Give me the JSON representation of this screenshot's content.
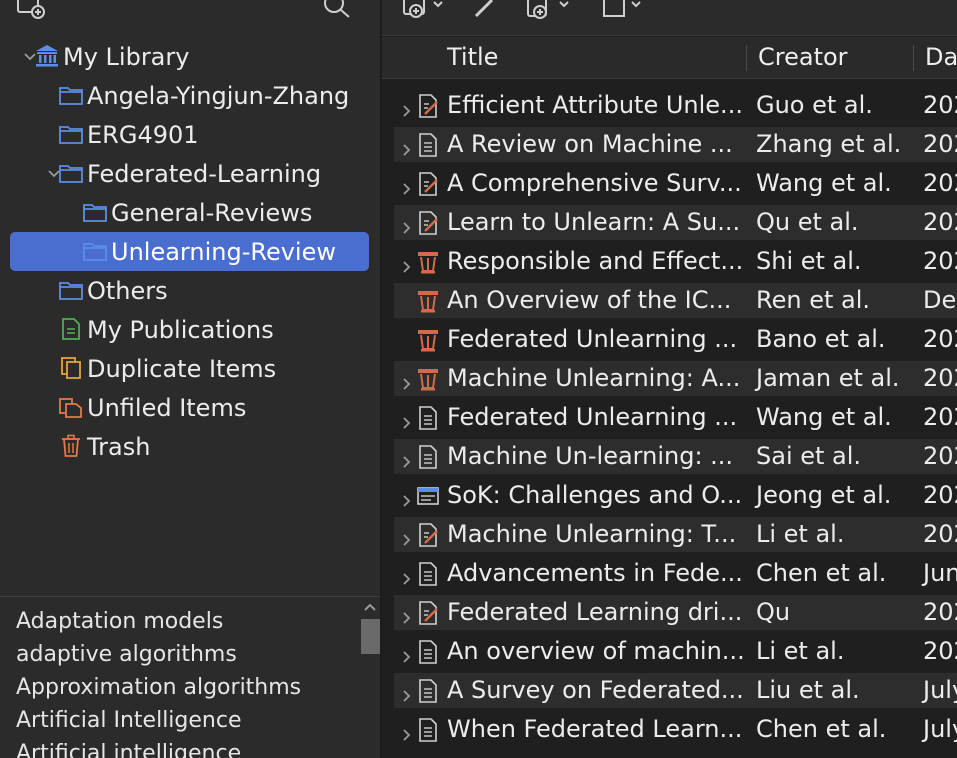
{
  "collections": [
    {
      "label": "My Library",
      "icon": "library-icon",
      "twisty": "expanded"
    },
    {
      "label": "Angela-Yingjun-Zhang",
      "icon": "folder-icon",
      "twisty": "none"
    },
    {
      "label": "ERG4901",
      "icon": "folder-icon",
      "twisty": "none"
    },
    {
      "label": "Federated-Learning",
      "icon": "folder-icon",
      "twisty": "expanded"
    },
    {
      "label": "General-Reviews",
      "icon": "folder-icon",
      "twisty": "none"
    },
    {
      "label": "Unlearning-Review",
      "icon": "folder-icon",
      "twisty": "none",
      "selected": true
    },
    {
      "label": "Others",
      "icon": "folder-icon",
      "twisty": "none"
    },
    {
      "label": "My Publications",
      "icon": "publications-icon",
      "twisty": "none"
    },
    {
      "label": "Duplicate Items",
      "icon": "duplicate-icon",
      "twisty": "none"
    },
    {
      "label": "Unfiled Items",
      "icon": "unfiled-icon",
      "twisty": "none"
    },
    {
      "label": "Trash",
      "icon": "trash-icon",
      "twisty": "none"
    }
  ],
  "tags": [
    "Adaptation models",
    "adaptive algorithms",
    "Approximation algorithms",
    "Artificial Intelligence",
    "Artificial intelligence"
  ],
  "columns": {
    "title": "Title",
    "creator": "Creator",
    "date": "Da"
  },
  "items": [
    {
      "title": "Efficient Attribute Unle...",
      "creator": "Guo et al.",
      "date": "202",
      "type": "preprint-icon",
      "twisty": true
    },
    {
      "title": "A Review on Machine ...",
      "creator": "Zhang et al.",
      "date": "202",
      "type": "document-icon",
      "twisty": true
    },
    {
      "title": "A Comprehensive Surv...",
      "creator": "Wang et al.",
      "date": "202",
      "type": "preprint-icon",
      "twisty": true
    },
    {
      "title": "Learn to Unlearn: A Su...",
      "creator": "Qu et al.",
      "date": "202",
      "type": "preprint-icon",
      "twisty": true
    },
    {
      "title": "Responsible and Effect...",
      "creator": "Shi et al.",
      "date": "202",
      "type": "conference-paper-icon",
      "twisty": true
    },
    {
      "title": "An Overview of the IC...",
      "creator": "Ren et al.",
      "date": "Dec",
      "type": "conference-paper-icon",
      "twisty": false
    },
    {
      "title": "Federated Unlearning ...",
      "creator": "Bano et al.",
      "date": "202",
      "type": "conference-paper-icon",
      "twisty": false
    },
    {
      "title": "Machine Unlearning: A...",
      "creator": "Jaman et al.",
      "date": "202",
      "type": "conference-paper-icon",
      "twisty": true
    },
    {
      "title": "Federated Unlearning ...",
      "creator": "Wang et al.",
      "date": "202",
      "type": "document-icon",
      "twisty": true
    },
    {
      "title": "Machine Un-learning: ...",
      "creator": "Sai et al.",
      "date": "202",
      "type": "document-icon",
      "twisty": true
    },
    {
      "title": "SoK: Challenges and O...",
      "creator": "Jeong et al.",
      "date": "202",
      "type": "webpage-icon",
      "twisty": true
    },
    {
      "title": "Machine Unlearning: T...",
      "creator": "Li et al.",
      "date": "202",
      "type": "preprint-icon",
      "twisty": true
    },
    {
      "title": "Advancements in Fede...",
      "creator": "Chen et al.",
      "date": "Jun",
      "type": "document-icon",
      "twisty": true
    },
    {
      "title": "Federated Learning dri...",
      "creator": "Qu",
      "date": "202",
      "type": "preprint-icon",
      "twisty": true
    },
    {
      "title": "An overview of machin...",
      "creator": "Li et al.",
      "date": "202",
      "type": "document-icon",
      "twisty": true
    },
    {
      "title": "A Survey on Federated...",
      "creator": "Liu et al.",
      "date": "July",
      "type": "document-icon",
      "twisty": true
    },
    {
      "title": "When Federated Learn...",
      "creator": "Chen et al.",
      "date": "July",
      "type": "document-icon",
      "twisty": true
    }
  ],
  "colors": {
    "accent": "#4a6ed0",
    "folder": "#5b8ee6",
    "publications": "#4caf50",
    "duplicate": "#e6a23c",
    "unfiled": "#e07a4a",
    "trash": "#e07a4a",
    "conference": "#d46a4a"
  }
}
